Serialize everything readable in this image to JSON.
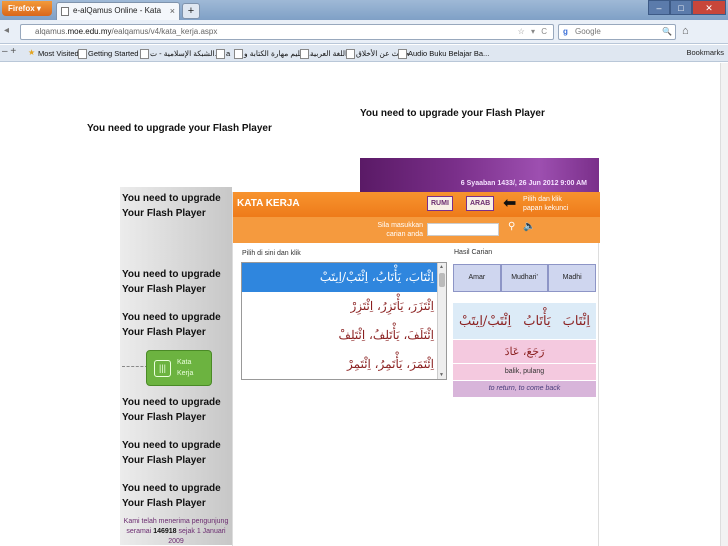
{
  "browser": {
    "menu_button": "Firefox ▾",
    "tab_title": "e-alQamus Online - Kata Kerja",
    "tab_close": "×",
    "new_tab": "+",
    "window_controls": [
      "–",
      "□",
      "✕"
    ],
    "url_domain": "alqamus.moe.edu.my",
    "url_path": "/ealqamus/v4/kata_kerja.aspx",
    "url_prefix": "alqamus.",
    "url_domain_bold": "moe.edu.my",
    "url_icons": "☆ ▾ C",
    "search_placeholder": "Google",
    "search_engine_letter": "g",
    "search_go": "🔍",
    "home_icon": "⌂",
    "nav_glyph": "◂"
  },
  "bookmarks": {
    "left_tools": "– +",
    "items": [
      "Most Visited",
      "Getting Started",
      "الشبكة الإسلامية - ت...",
      "a",
      "تعليم مهارة الكتابة و...",
      "اللغة العربية",
      "حديث عن الأخلاق",
      "Audio Buku Belajar Ba..."
    ],
    "right": "Bookmarks"
  },
  "page": {
    "flash_message": "You need to upgrade your Flash Player",
    "left_flash": [
      "You need to upgrade",
      "Your Flash Player"
    ],
    "banner_date": "6 Syaaban 1433/, 26 Jun 2012     9:00 AM",
    "kata_kerja_button": {
      "line1": "Kata",
      "line2": "Kerja",
      "icon": "|||"
    },
    "visitor_prefix": "Kami telah menerima pengunjung seramai",
    "visitor_count": "146918",
    "visitor_suffix": "sejak 1 Januari 2009"
  },
  "app": {
    "title": "KATA KERJA",
    "rumi_button": "RUMI",
    "arab_button": "ARAB",
    "arrow": "⬅",
    "hint": [
      "Pilih dan klik",
      "papan kekunci"
    ],
    "search_prompt": [
      "Sila masukkan",
      "carian anda"
    ],
    "search_value": "",
    "choose_label": "Pilih di sini dan klik",
    "word_list": [
      "اِئْتَابَ، يَأْتَابُ، اِئْتَبْ/اِيتَبْ",
      "اِئْتَزَرَ، يَأْتَزِرُ، اِئْتَزِرْ",
      "اِئْتَلَفَ، يَأْتَلِفُ، اِئْتَلِفْ",
      "اِئْتَمَرَ، يَأْتَمِرُ، اِئْتَمِرْ"
    ],
    "result_label": "Hasil Carian",
    "columns": [
      "Amar",
      "Mudhari'",
      "Madhi"
    ],
    "result_forms": [
      "اِئْتَابَ",
      "يَأْتَابُ",
      "اِئْتَبْ/اِيتَبْ"
    ],
    "result_synonym": "رَجَعَ، عَادَ",
    "result_malay": "balik, pulang",
    "result_english": "to return, to come back"
  }
}
